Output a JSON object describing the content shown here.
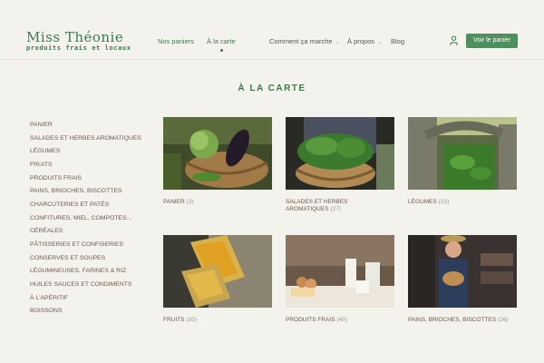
{
  "brand": {
    "name": "Miss Théonie",
    "tagline": "produits frais et locaux"
  },
  "nav": {
    "items": [
      {
        "label": "Nos paniers"
      },
      {
        "label": "À la carte"
      },
      {
        "label": "Comment ça marche"
      },
      {
        "label": "À propos"
      },
      {
        "label": "Blog"
      }
    ],
    "cart_button": "Voir le panier",
    "user_icon": "user-icon"
  },
  "page_title": "À LA CARTE",
  "sidebar": {
    "items": [
      "PANIER",
      "SALADES ET HERBES AROMATIQUES",
      "LÉGUMES",
      "FRUITS",
      "PRODUITS FRAIS",
      "PAINS, BRIOCHES, BISCOTTES",
      "CHARCUTERIES ET PATÉS",
      "CONFITURES, MIEL, COMPOTES...",
      "CÉRÉALES",
      "PÂTISSERIES ET CONFISERIES",
      "CONSERVES ET SOUPES",
      "LÉGUMINEUSES, FARINES & RIZ",
      "HUILES SAUCES ET CONDIMENTS",
      "À L'APÉRITIF",
      "BOISSONS"
    ]
  },
  "categories": [
    {
      "name": "PANIER",
      "count": "(3)"
    },
    {
      "name": "SALADES ET HERBES AROMATIQUES",
      "count": "(27)"
    },
    {
      "name": "LÉGUMES",
      "count": "(33)"
    },
    {
      "name": "FRUITS",
      "count": "(33)"
    },
    {
      "name": "PRODUITS FRAIS",
      "count": "(40)"
    },
    {
      "name": "PAINS, BRIOCHES, BISCOTTES",
      "count": "(26)"
    }
  ],
  "colors": {
    "accent": "#3d7a4a",
    "button": "#4e8f5d",
    "background": "#f4f2ec",
    "label": "#6b5a4a"
  }
}
